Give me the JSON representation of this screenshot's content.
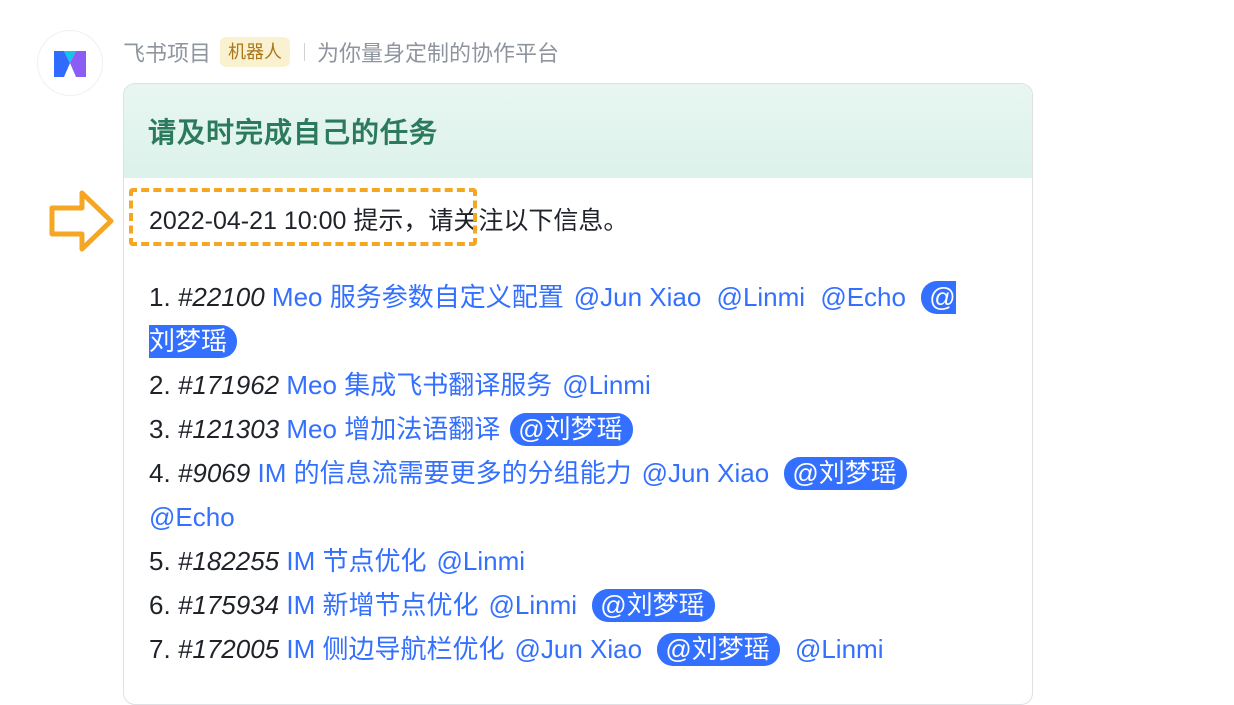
{
  "header": {
    "app_name": "飞书项目",
    "bot_tag": "机器人",
    "slogan": "为你量身定制的协作平台"
  },
  "card": {
    "title": "请及时完成自己的任务",
    "intro": {
      "highlighted": "2022-04-21 10:00 提示，",
      "rest": "请关注以下信息。"
    },
    "tasks": [
      {
        "num": "1.",
        "id": "#22100",
        "title": "Meo 服务参数自定义配置",
        "mentions": [
          {
            "text": "@Jun Xiao"
          },
          {
            "text": "@Linmi"
          },
          {
            "text": "@Echo"
          },
          {
            "text": "@刘梦瑶",
            "self": true
          }
        ]
      },
      {
        "num": "2.",
        "id": "#171962",
        "title": "Meo 集成飞书翻译服务",
        "mentions": [
          {
            "text": "@Linmi"
          }
        ]
      },
      {
        "num": "3.",
        "id": "#121303",
        "title": "Meo 增加法语翻译",
        "mentions": [
          {
            "text": "@刘梦瑶",
            "self": true
          }
        ]
      },
      {
        "num": "4.",
        "id": "#9069",
        "title": "IM 的信息流需要更多的分组能力",
        "mentions": [
          {
            "text": "@Jun Xiao"
          },
          {
            "text": "@刘梦瑶",
            "self": true
          },
          {
            "text": "@Echo"
          }
        ]
      },
      {
        "num": "5.",
        "id": "#182255",
        "title": "IM 节点优化",
        "mentions": [
          {
            "text": "@Linmi"
          }
        ]
      },
      {
        "num": "6.",
        "id": "#175934",
        "title": "IM 新增节点优化",
        "mentions": [
          {
            "text": "@Linmi"
          },
          {
            "text": "@刘梦瑶",
            "self": true
          }
        ]
      },
      {
        "num": "7.",
        "id": "#172005",
        "title": "IM 侧边导航栏优化",
        "mentions": [
          {
            "text": "@Jun Xiao"
          },
          {
            "text": "@刘梦瑶",
            "self": true
          },
          {
            "text": "@Linmi"
          }
        ]
      }
    ]
  },
  "colors": {
    "link": "#3370ff",
    "highlight": "#f5a623",
    "header_green": "#2b7a5e"
  }
}
